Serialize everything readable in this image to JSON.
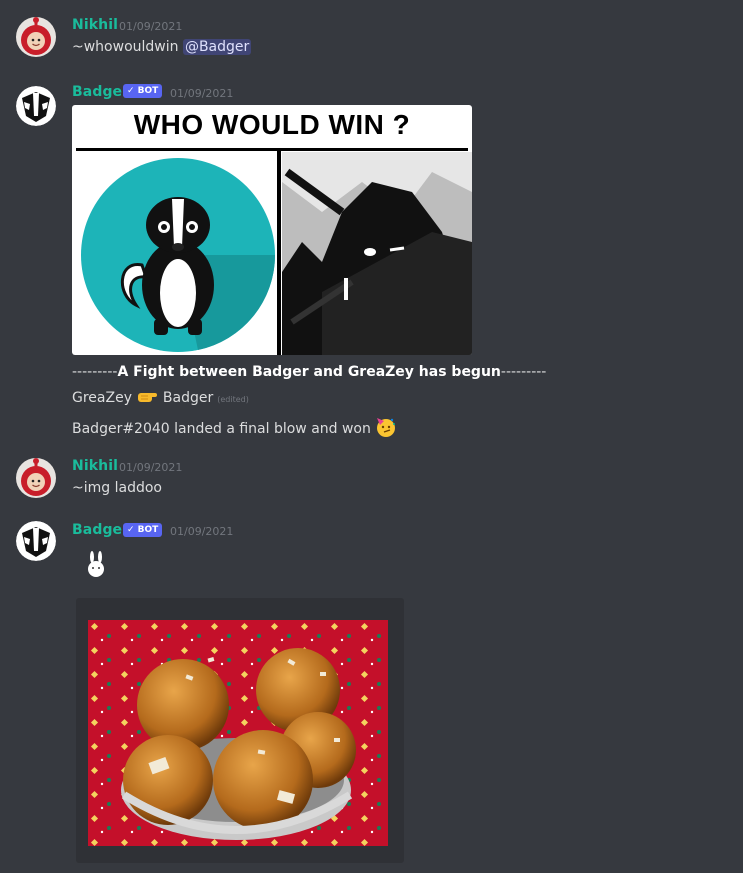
{
  "messages": [
    {
      "author": "Nikhil",
      "timestamp": "01/09/2021",
      "text": "~whowouldwin ",
      "mention": "@Badger"
    },
    {
      "author": "Badger",
      "bot_badge": "✓ BOT",
      "timestamp": "01/09/2021",
      "meme_title": "WHO WOULD WIN ?",
      "fight_prefix": "---------",
      "fight_text": "A Fight between Badger and GreaZey has begun",
      "fight_suffix": "---------",
      "versus_left": "GreaZey",
      "versus_right": "Badger",
      "edited": "(edited)",
      "result": "Badger#2040 landed a final blow and won"
    },
    {
      "author": "Nikhil",
      "timestamp": "01/09/2021",
      "text": "~img laddoo"
    },
    {
      "author": "Badger",
      "bot_badge": "✓ BOT",
      "timestamp": "01/09/2021"
    }
  ],
  "colors": {
    "username": "#1abc9c",
    "badge": "#5865f2",
    "background": "#36393f"
  },
  "icons": {
    "versus": "pointing-fist-emoji",
    "win": "party-face-emoji",
    "bunny": "bunny-emoji"
  }
}
